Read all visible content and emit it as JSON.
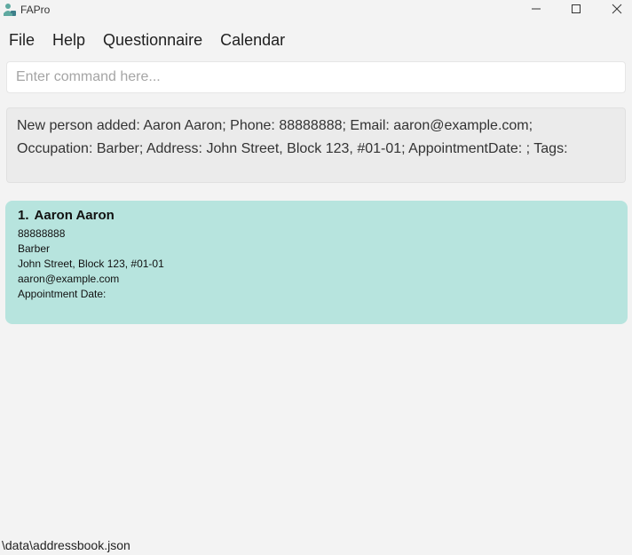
{
  "window": {
    "title": "FAPro",
    "icon": "app-logo-icon",
    "controls": [
      "minimize-icon",
      "maximize-icon",
      "close-icon"
    ]
  },
  "menu": {
    "items": [
      "File",
      "Help",
      "Questionnaire",
      "Calendar"
    ]
  },
  "command": {
    "placeholder": "Enter command here...",
    "value": ""
  },
  "result": {
    "line1": "New person added: Aaron Aaron; Phone: 88888888; Email: aaron@example.com;",
    "line2": "Occupation: Barber; Address: John Street, Block 123, #01-01; AppointmentDate: ; Tags:"
  },
  "persons": [
    {
      "index": "1.",
      "name": "Aaron Aaron",
      "phone": "88888888",
      "occupation": "Barber",
      "address": "John Street, Block 123, #01-01",
      "email": "aaron@example.com",
      "appointment": "Appointment Date:"
    }
  ],
  "status": {
    "path": "\\data\\addressbook.json"
  },
  "colors": {
    "card": "#b7e4de",
    "background": "#f3f3f3",
    "result_bg": "#ebebeb"
  }
}
